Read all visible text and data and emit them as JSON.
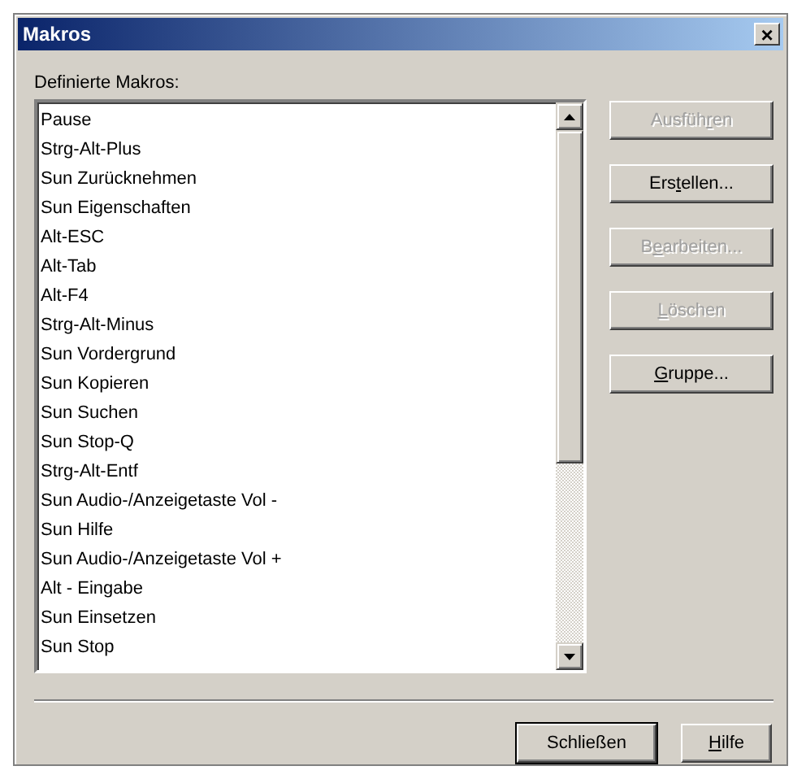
{
  "window": {
    "title": "Makros",
    "close": "×"
  },
  "list_label": "Definierte Makros:",
  "macros": [
    {
      "label": "Pause"
    },
    {
      "label": "Strg-Alt-Plus"
    },
    {
      "label": "Sun Zurücknehmen"
    },
    {
      "label": "Sun Eigenschaften"
    },
    {
      "label": "Alt-ESC"
    },
    {
      "label": "Alt-Tab"
    },
    {
      "label": "Alt-F4"
    },
    {
      "label": "Strg-Alt-Minus"
    },
    {
      "label": "Sun Vordergrund"
    },
    {
      "label": "Sun Kopieren"
    },
    {
      "label": "Sun Suchen"
    },
    {
      "label": "Sun Stop-Q"
    },
    {
      "label": "Strg-Alt-Entf"
    },
    {
      "label": "Sun Audio-/Anzeigetaste Vol -"
    },
    {
      "label": "Sun Hilfe"
    },
    {
      "label": "Sun Audio-/Anzeigetaste Vol +"
    },
    {
      "label": "Alt - Eingabe"
    },
    {
      "label": "Sun Einsetzen"
    },
    {
      "label": "Sun Stop"
    }
  ],
  "side_buttons": [
    {
      "label": "Ausfüh",
      "access_key": "r",
      "label_end": "en",
      "disabled": true
    },
    {
      "label": "Ers",
      "access_key": "t",
      "label_end": "ellen...",
      "disabled": false
    },
    {
      "label": "B",
      "access_key": "e",
      "label_end": "arbeiten...",
      "disabled": true
    },
    {
      "access_key": "L",
      "label_end": "öschen",
      "disabled": true
    },
    {
      "access_key": "G",
      "label_end": "ruppe...",
      "disabled": false
    }
  ],
  "bottom_buttons": [
    {
      "label": "Schließen",
      "default": true
    },
    {
      "access_key": "H",
      "label_end": "ilfe",
      "default": false
    }
  ]
}
